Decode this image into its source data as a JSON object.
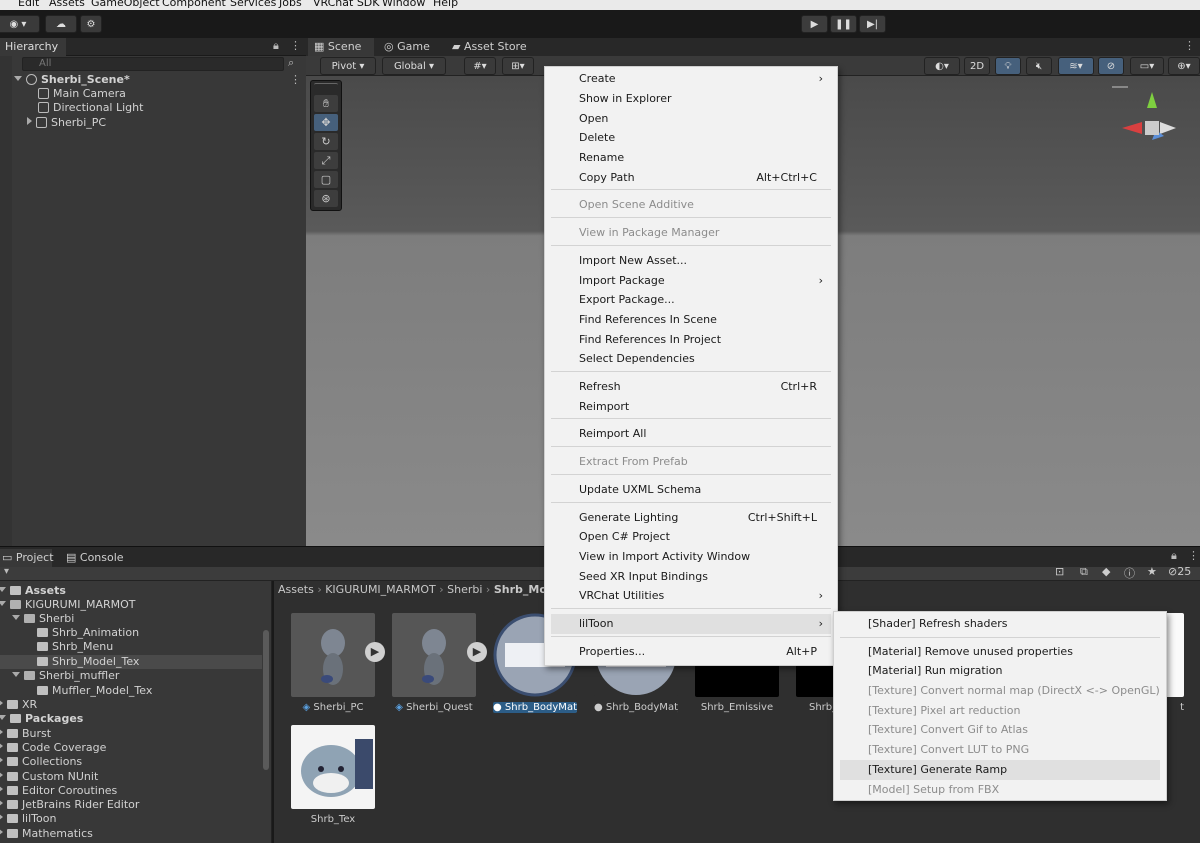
{
  "menubar": [
    "Edit",
    "Assets",
    "GameObject",
    "Component",
    "Services",
    "Jobs",
    "VRChat SDK",
    "Window",
    "Help"
  ],
  "hierarchy": {
    "tab": "Hierarchy",
    "search_placeholder": "All",
    "items": [
      "Sherbi_Scene*",
      "Main Camera",
      "Directional Light",
      "Sherbi_PC"
    ]
  },
  "scene": {
    "tabs": [
      "Scene",
      "Game",
      "Asset Store"
    ],
    "pivot": "Pivot",
    "global": "Global",
    "mode_2d": "2D"
  },
  "project": {
    "tabs": [
      "Project",
      "Console"
    ],
    "tree": [
      {
        "label": "Assets",
        "bold": true
      },
      {
        "label": "KIGURUMI_MARMOT"
      },
      {
        "label": "Sherbi"
      },
      {
        "label": "Shrb_Animation"
      },
      {
        "label": "Shrb_Menu"
      },
      {
        "label": "Shrb_Model_Tex"
      },
      {
        "label": "Sherbi_muffler"
      },
      {
        "label": "Muffler_Model_Tex"
      },
      {
        "label": "XR"
      },
      {
        "label": "Packages",
        "bold": true
      },
      {
        "label": "Burst"
      },
      {
        "label": "Code Coverage"
      },
      {
        "label": "Collections"
      },
      {
        "label": "Custom NUnit"
      },
      {
        "label": "Editor Coroutines"
      },
      {
        "label": "JetBrains Rider Editor"
      },
      {
        "label": "lilToon"
      },
      {
        "label": "Mathematics"
      }
    ],
    "breadcrumb": [
      "Assets",
      "KIGURUMI_MARMOT",
      "Sherbi",
      "Shrb_Mo"
    ],
    "count": "25",
    "assets": [
      "Sherbi_PC",
      "Sherbi_Quest",
      "Shrb_BodyMat_PC",
      "Shrb_BodyMat_Q...",
      "Shrb_Emissive",
      "Shrb_",
      "Shrb_Tex"
    ],
    "cut_label": "t"
  },
  "context_menu": [
    {
      "label": "Create",
      "submenu": true
    },
    {
      "label": "Show in Explorer"
    },
    {
      "label": "Open"
    },
    {
      "label": "Delete"
    },
    {
      "label": "Rename"
    },
    {
      "label": "Copy Path",
      "shortcut": "Alt+Ctrl+C"
    },
    {
      "sep": true
    },
    {
      "label": "Open Scene Additive",
      "disabled": true
    },
    {
      "sep": true
    },
    {
      "label": "View in Package Manager",
      "disabled": true
    },
    {
      "sep": true
    },
    {
      "label": "Import New Asset..."
    },
    {
      "label": "Import Package",
      "submenu": true
    },
    {
      "label": "Export Package..."
    },
    {
      "label": "Find References In Scene"
    },
    {
      "label": "Find References In Project"
    },
    {
      "label": "Select Dependencies"
    },
    {
      "sep": true
    },
    {
      "label": "Refresh",
      "shortcut": "Ctrl+R"
    },
    {
      "label": "Reimport"
    },
    {
      "sep": true
    },
    {
      "label": "Reimport All"
    },
    {
      "sep": true
    },
    {
      "label": "Extract From Prefab",
      "disabled": true
    },
    {
      "sep": true
    },
    {
      "label": "Update UXML Schema"
    },
    {
      "sep": true
    },
    {
      "label": "Generate Lighting",
      "shortcut": "Ctrl+Shift+L"
    },
    {
      "label": "Open C# Project"
    },
    {
      "label": "View in Import Activity Window"
    },
    {
      "label": "Seed XR Input Bindings"
    },
    {
      "label": "VRChat Utilities",
      "submenu": true
    },
    {
      "sep": true
    },
    {
      "label": "lilToon",
      "submenu": true,
      "highlighted": true
    },
    {
      "sep": true
    },
    {
      "label": "Properties...",
      "shortcut": "Alt+P"
    }
  ],
  "submenu": [
    {
      "label": "[Shader] Refresh shaders"
    },
    {
      "sep": true
    },
    {
      "label": "[Material] Remove unused properties"
    },
    {
      "label": "[Material] Run migration"
    },
    {
      "label": "[Texture] Convert normal map (DirectX <-> OpenGL)",
      "disabled": true
    },
    {
      "label": "[Texture] Pixel art reduction",
      "disabled": true
    },
    {
      "label": "[Texture] Convert Gif to Atlas",
      "disabled": true
    },
    {
      "label": "[Texture] Convert LUT to PNG",
      "disabled": true
    },
    {
      "label": "[Texture] Generate Ramp",
      "highlighted": true
    },
    {
      "label": "[Model] Setup from FBX",
      "disabled": true
    }
  ]
}
